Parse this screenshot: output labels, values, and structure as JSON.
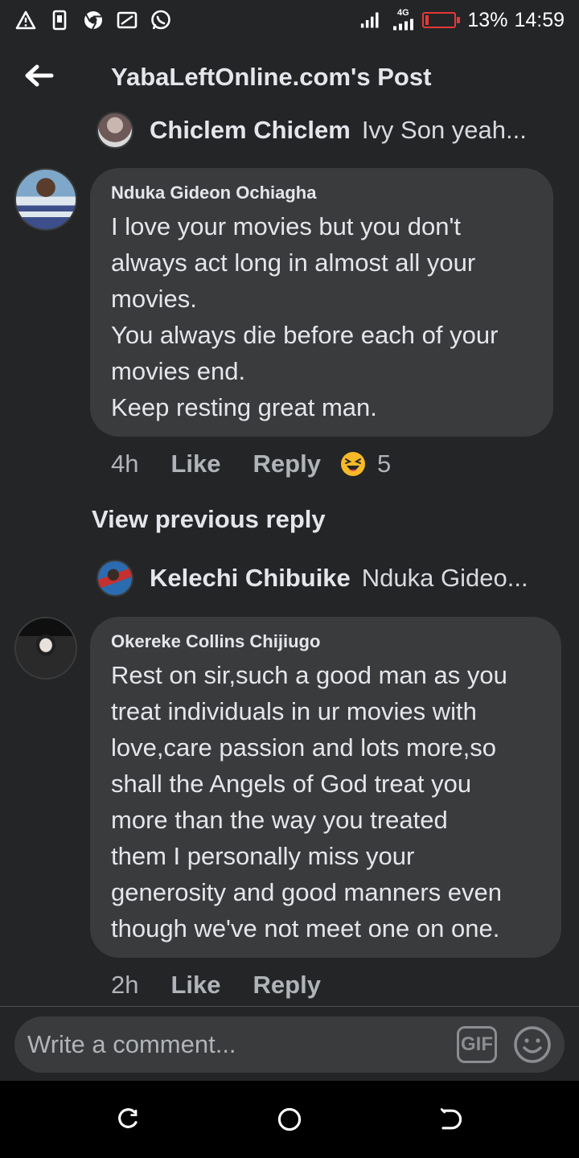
{
  "status_bar": {
    "icons": [
      "warning-triangle-icon",
      "sim-card-icon",
      "chrome-icon",
      "cast-icon",
      "whatsapp-icon"
    ],
    "network": "4G",
    "battery_percent": "13%",
    "battery_level": 0.13,
    "time": "14:59",
    "battery_color": "#e53935"
  },
  "header": {
    "back_icon": "arrow-left-icon",
    "title": "YabaLeftOnline.com's Post"
  },
  "thread": {
    "top_reply": {
      "name": "Chiclem Chiclem",
      "snippet": "Ivy Son yeah..."
    },
    "comments": [
      {
        "author": "Nduka Gideon Ochiagha",
        "text": "I love your movies but you don't\nalways act long in almost all your\nmovies.\nYou always die before each of your\nmovies end.\nKeep resting great man.",
        "time": "4h",
        "like_label": "Like",
        "reply_label": "Reply",
        "reaction_icon": "laughing-emoji-icon",
        "reaction_count": "5"
      },
      {
        "author": "Okereke Collins Chijiugo",
        "text": "Rest on sir,such a good man as you\ntreat individuals in ur movies with\nlove,care passion and lots more,so\nshall the Angels of God treat you\nmore than the way you treated\nthem I personally miss your\ngenerosity and good manners even\nthough we've not meet one on one.",
        "time": "2h",
        "like_label": "Like",
        "reply_label": "Reply"
      }
    ],
    "view_previous": "View previous reply",
    "nested_reply": {
      "name": "Kelechi Chibuike",
      "snippet": "Nduka Gideo..."
    }
  },
  "composer": {
    "placeholder": "Write a comment...",
    "gif_label": "GIF",
    "emoji_icon": "smiley-icon"
  },
  "nav_bar": {
    "icons": [
      "recent-apps-icon",
      "home-icon",
      "back-icon"
    ]
  },
  "colors": {
    "background": "#242527",
    "bubble": "#3a3b3c",
    "text": "#e4e6eb",
    "secondary_text": "#b0b3b8"
  }
}
